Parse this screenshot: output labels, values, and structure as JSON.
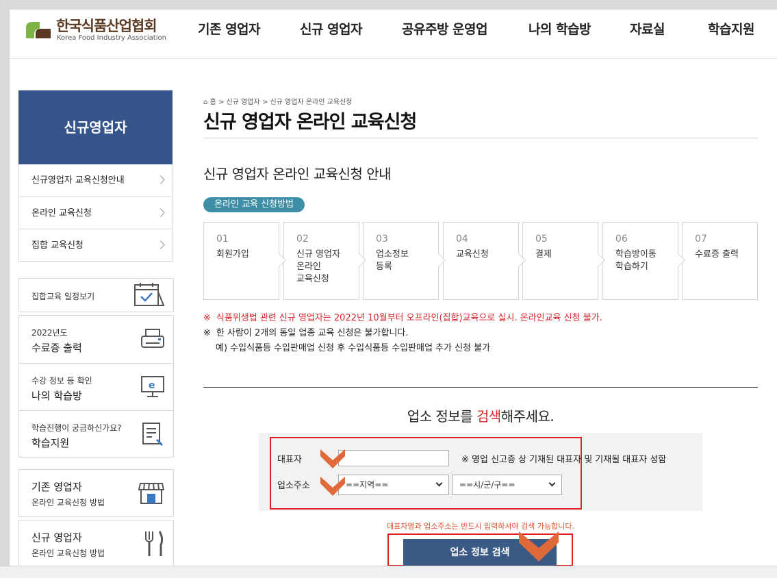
{
  "header": {
    "logo_kor": "한국식품산업협회",
    "logo_eng": "Korea Food Industry Association",
    "nav": [
      "기존 영업자",
      "신규 영업자",
      "공유주방 운영업",
      "나의 학습방",
      "자료실",
      "학습지원"
    ]
  },
  "sidebar": {
    "title": "신규영업자",
    "menu": [
      "신규영업자 교육신청안내",
      "온라인 교육신청",
      "집합 교육신청"
    ],
    "schedule": "집합교육 일정보기",
    "certificate": {
      "small": "2022년도",
      "big": "수료증 출력"
    },
    "mystudy": {
      "small": "수강 정보 등 확인",
      "big": "나의 학습방"
    },
    "support": {
      "small": "학습진행이 궁금하신가요?",
      "big": "학습지원"
    },
    "existing": {
      "big": "기존 영업자",
      "small": "온라인 교육신청 방법"
    },
    "new": {
      "big": "신규 영업자",
      "small": "온라인 교육신청 방법"
    }
  },
  "breadcrumb": {
    "home": "홈",
    "level1": "신규 영업자",
    "level2": "신규 영업자 온라인 교육신청"
  },
  "page_title": "신규 영업자 온라인 교육신청",
  "section_title": "신규 영업자 온라인 교육신청 안내",
  "pill": "온라인 교육 신청방법",
  "steps": [
    {
      "num": "01",
      "label": "회원가입"
    },
    {
      "num": "02",
      "label": "신규 영업자\n온라인\n교육신청"
    },
    {
      "num": "03",
      "label": "업소정보\n등록"
    },
    {
      "num": "04",
      "label": "교육신청"
    },
    {
      "num": "05",
      "label": "결제"
    },
    {
      "num": "06",
      "label": "학습방이동\n학습하기"
    },
    {
      "num": "07",
      "label": "수료증 출력"
    }
  ],
  "notices": {
    "mark": "※",
    "red": "식품위생법 관련 신규 영업자는 2022년 10월부터 오프라인(집합)교육으로 실시. 온라인교육 신청 불가.",
    "line2": "한 사람이 2개의 동일 업종 교육 신청은 불가합니다.",
    "line3": "예) 수입식품등 수입판매업 신청 후 수입식품등 수입판매업 추가 신청 불가"
  },
  "search": {
    "title_pre": "업소 정보를 ",
    "title_hl": "검색",
    "title_post": "해주세요.",
    "rep_label": "대표자",
    "rep_value": "",
    "rep_note": "※ 영업 신고증 상 기재된 대표자 및 기재될 대표자 성함",
    "addr_label": "업소주소",
    "region": "==지역==",
    "city": "==시/군/구==",
    "warning": "대표자명과 업소주소는 반드시 입력하셔야 검색 가능합니다.",
    "button": "업소 정보 검색"
  },
  "colors": {
    "brand": "#35548a",
    "accent_red": "#d8262c",
    "pill": "#3f8ea8",
    "button": "#3a5a85",
    "marker": "#e0693a"
  }
}
